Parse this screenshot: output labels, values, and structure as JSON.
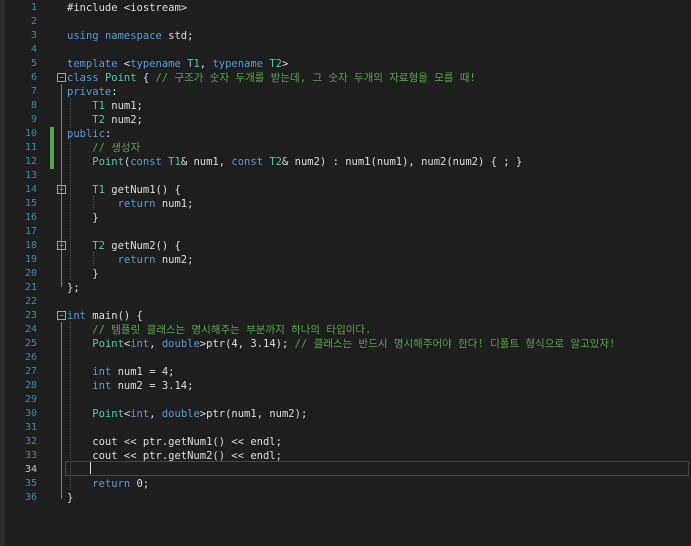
{
  "editor": {
    "current_line": 34,
    "lines": [
      {
        "n": "1",
        "fold": "",
        "chg": false,
        "tokens": [
          {
            "t": "#include <iostream>",
            "c": "tx"
          }
        ]
      },
      {
        "n": "2",
        "fold": "",
        "chg": false,
        "tokens": []
      },
      {
        "n": "3",
        "fold": "",
        "chg": false,
        "tokens": [
          {
            "t": "using",
            "c": "kw"
          },
          {
            "t": " ",
            "c": "tx"
          },
          {
            "t": "namespace",
            "c": "kw"
          },
          {
            "t": " std;",
            "c": "tx"
          }
        ]
      },
      {
        "n": "4",
        "fold": "",
        "chg": false,
        "tokens": []
      },
      {
        "n": "5",
        "fold": "",
        "chg": false,
        "tokens": [
          {
            "t": "template",
            "c": "kw"
          },
          {
            "t": " <",
            "c": "tx"
          },
          {
            "t": "typename",
            "c": "kw"
          },
          {
            "t": " ",
            "c": "tx"
          },
          {
            "t": "T1",
            "c": "ty"
          },
          {
            "t": ", ",
            "c": "tx"
          },
          {
            "t": "typename",
            "c": "kw"
          },
          {
            "t": " ",
            "c": "tx"
          },
          {
            "t": "T2",
            "c": "ty"
          },
          {
            "t": ">",
            "c": "tx"
          }
        ]
      },
      {
        "n": "6",
        "fold": "−",
        "chg": false,
        "tokens": [
          {
            "t": "class",
            "c": "kw"
          },
          {
            "t": " ",
            "c": "tx"
          },
          {
            "t": "Point",
            "c": "ty"
          },
          {
            "t": " { ",
            "c": "tx"
          },
          {
            "t": "// 구조가 숫자 두개를 받는데, 그 숫자 두개의 자료형을 모를 때!",
            "c": "cm"
          }
        ]
      },
      {
        "n": "7",
        "fold": "",
        "chg": false,
        "tokens": [
          {
            "t": "private",
            "c": "kw"
          },
          {
            "t": ":",
            "c": "tx"
          }
        ]
      },
      {
        "n": "8",
        "fold": "",
        "chg": false,
        "tokens": [
          {
            "t": "    ",
            "c": "tx"
          },
          {
            "t": "T1",
            "c": "ty"
          },
          {
            "t": " num1;",
            "c": "tx"
          }
        ]
      },
      {
        "n": "9",
        "fold": "",
        "chg": false,
        "tokens": [
          {
            "t": "    ",
            "c": "tx"
          },
          {
            "t": "T2",
            "c": "ty"
          },
          {
            "t": " num2;",
            "c": "tx"
          }
        ]
      },
      {
        "n": "10",
        "fold": "",
        "chg": true,
        "tokens": [
          {
            "t": "public",
            "c": "kw"
          },
          {
            "t": ":",
            "c": "tx"
          }
        ]
      },
      {
        "n": "11",
        "fold": "",
        "chg": true,
        "tokens": [
          {
            "t": "    ",
            "c": "tx"
          },
          {
            "t": "// 생성자",
            "c": "cm"
          }
        ]
      },
      {
        "n": "12",
        "fold": "",
        "chg": true,
        "tokens": [
          {
            "t": "    ",
            "c": "tx"
          },
          {
            "t": "Point",
            "c": "ty"
          },
          {
            "t": "(",
            "c": "tx"
          },
          {
            "t": "const",
            "c": "kw"
          },
          {
            "t": " ",
            "c": "tx"
          },
          {
            "t": "T1",
            "c": "ty"
          },
          {
            "t": "& num1, ",
            "c": "tx"
          },
          {
            "t": "const",
            "c": "kw"
          },
          {
            "t": " ",
            "c": "tx"
          },
          {
            "t": "T2",
            "c": "ty"
          },
          {
            "t": "& num2) : num1(num1), num2(num2) { ; }",
            "c": "tx"
          }
        ]
      },
      {
        "n": "13",
        "fold": "",
        "chg": false,
        "tokens": []
      },
      {
        "n": "14",
        "fold": "−",
        "chg": false,
        "tokens": [
          {
            "t": "    ",
            "c": "tx"
          },
          {
            "t": "T1",
            "c": "ty"
          },
          {
            "t": " getNum1() {",
            "c": "tx"
          }
        ]
      },
      {
        "n": "15",
        "fold": "",
        "chg": false,
        "tokens": [
          {
            "t": "        ",
            "c": "tx"
          },
          {
            "t": "return",
            "c": "kw"
          },
          {
            "t": " num1;",
            "c": "tx"
          }
        ]
      },
      {
        "n": "16",
        "fold": "",
        "chg": false,
        "tokens": [
          {
            "t": "    }",
            "c": "tx"
          }
        ]
      },
      {
        "n": "17",
        "fold": "",
        "chg": false,
        "tokens": []
      },
      {
        "n": "18",
        "fold": "−",
        "chg": false,
        "tokens": [
          {
            "t": "    ",
            "c": "tx"
          },
          {
            "t": "T2",
            "c": "ty"
          },
          {
            "t": " getNum2() {",
            "c": "tx"
          }
        ]
      },
      {
        "n": "19",
        "fold": "",
        "chg": false,
        "tokens": [
          {
            "t": "        ",
            "c": "tx"
          },
          {
            "t": "return",
            "c": "kw"
          },
          {
            "t": " num2;",
            "c": "tx"
          }
        ]
      },
      {
        "n": "20",
        "fold": "",
        "chg": false,
        "tokens": [
          {
            "t": "    }",
            "c": "tx"
          }
        ]
      },
      {
        "n": "21",
        "fold": "",
        "chg": false,
        "tokens": [
          {
            "t": "};",
            "c": "tx"
          }
        ]
      },
      {
        "n": "22",
        "fold": "",
        "chg": false,
        "tokens": []
      },
      {
        "n": "23",
        "fold": "−",
        "chg": false,
        "tokens": [
          {
            "t": "int",
            "c": "kw"
          },
          {
            "t": " main() {",
            "c": "tx"
          }
        ]
      },
      {
        "n": "24",
        "fold": "",
        "chg": false,
        "tokens": [
          {
            "t": "    ",
            "c": "tx"
          },
          {
            "t": "// 템플릿 클래스는 명시해주는 부분까지 하나의 타입이다.",
            "c": "cm"
          }
        ]
      },
      {
        "n": "25",
        "fold": "",
        "chg": false,
        "tokens": [
          {
            "t": "    ",
            "c": "tx"
          },
          {
            "t": "Point",
            "c": "ty"
          },
          {
            "t": "<",
            "c": "tx"
          },
          {
            "t": "int",
            "c": "kw"
          },
          {
            "t": ", ",
            "c": "tx"
          },
          {
            "t": "double",
            "c": "kw"
          },
          {
            "t": ">ptr(4, 3.14); ",
            "c": "tx"
          },
          {
            "t": "// 클래스는 반드시 명시해주어야 한다! 디폴트 형식으로 알고있자!",
            "c": "cm"
          }
        ]
      },
      {
        "n": "26",
        "fold": "",
        "chg": false,
        "tokens": []
      },
      {
        "n": "27",
        "fold": "",
        "chg": false,
        "tokens": [
          {
            "t": "    ",
            "c": "tx"
          },
          {
            "t": "int",
            "c": "kw"
          },
          {
            "t": " num1 = 4;",
            "c": "tx"
          }
        ]
      },
      {
        "n": "28",
        "fold": "",
        "chg": false,
        "tokens": [
          {
            "t": "    ",
            "c": "tx"
          },
          {
            "t": "int",
            "c": "kw"
          },
          {
            "t": " num2 = 3.14;",
            "c": "tx"
          }
        ]
      },
      {
        "n": "29",
        "fold": "",
        "chg": false,
        "tokens": []
      },
      {
        "n": "30",
        "fold": "",
        "chg": false,
        "tokens": [
          {
            "t": "    ",
            "c": "tx"
          },
          {
            "t": "Point",
            "c": "ty"
          },
          {
            "t": "<",
            "c": "tx"
          },
          {
            "t": "int",
            "c": "kw"
          },
          {
            "t": ", ",
            "c": "tx"
          },
          {
            "t": "double",
            "c": "kw"
          },
          {
            "t": ">ptr(num1, num2);",
            "c": "tx"
          }
        ]
      },
      {
        "n": "31",
        "fold": "",
        "chg": false,
        "tokens": []
      },
      {
        "n": "32",
        "fold": "",
        "chg": false,
        "tokens": [
          {
            "t": "    cout << ptr.getNum1() << endl;",
            "c": "tx"
          }
        ]
      },
      {
        "n": "33",
        "fold": "",
        "chg": false,
        "tokens": [
          {
            "t": "    cout << ptr.getNum2() << endl;",
            "c": "tx"
          }
        ]
      },
      {
        "n": "34",
        "fold": "",
        "chg": false,
        "tokens": []
      },
      {
        "n": "35",
        "fold": "",
        "chg": false,
        "tokens": [
          {
            "t": "    ",
            "c": "tx"
          },
          {
            "t": "return",
            "c": "kw"
          },
          {
            "t": " 0;",
            "c": "tx"
          }
        ]
      },
      {
        "n": "36",
        "fold": "",
        "chg": false,
        "tokens": [
          {
            "t": "}",
            "c": "tx"
          }
        ]
      }
    ]
  }
}
